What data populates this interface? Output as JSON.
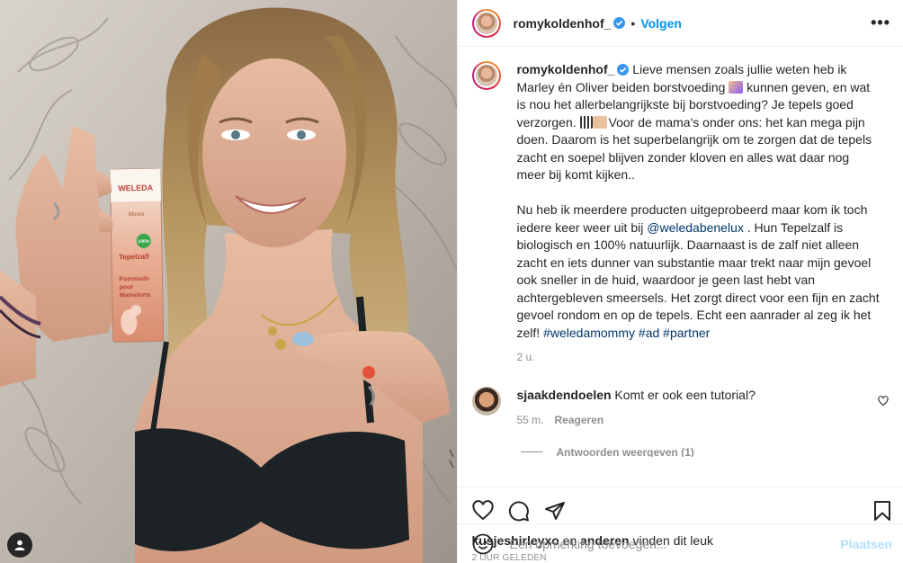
{
  "header": {
    "username": "romykoldenhof_",
    "dot": "•",
    "follow_label": "Volgen",
    "more_label": "•••"
  },
  "caption": {
    "username": "romykoldenhof_",
    "text_1": " Lieve mensen zoals jullie weten heb ik Marley én Oliver beiden borstvoeding ",
    "text_2": " kunnen geven, en wat is nou het allerbelangrijkste bij borstvoeding? Je tepels goed verzorgen. ",
    "text_3": "Voor de mama's onder ons: het kan mega pijn doen. Daarom is het superbelangrijk om te zorgen dat de tepels zacht en soepel blijven zonder kloven en alles wat daar nog meer bij komt kijken..",
    "text_4a": "Nu heb ik meerdere producten uitgeprobeerd maar kom ik toch iedere keer weer uit bij ",
    "mention": "@weledabenelux",
    "text_4b": " . Hun Tepelzalf is biologisch en 100% natuurlijk. Daarnaast is de zalf niet alleen zacht en iets dunner van substantie maar trekt naar mijn gevoel ook sneller in de huid, waardoor je geen last hebt van achtergebleven smeersels. Het zorgt direct voor een fijn en zacht gevoel rondom en op de tepels. Echt een aanrader al zeg ik het zelf! ",
    "hashtag_1": "#weledamommy",
    "hashtag_2": "#ad",
    "hashtag_3": "#partner",
    "time": "2 u."
  },
  "comments": [
    {
      "username": "sjaakdendoelen",
      "text": " Komt er ook een tutorial?",
      "time": "55 m.",
      "reply_label": "Reageren",
      "view_replies": "Antwoorden weergeven (1)"
    }
  ],
  "likes": {
    "user": "kusjeshirleyxo",
    "conj": " en ",
    "others": "anderen",
    "suffix": " vinden dit leuk"
  },
  "posted_ago": "2 UUR GELEDEN",
  "add_comment": {
    "placeholder": "Een opmerking toevoegen...",
    "post_label": "Plaatsen"
  },
  "product": {
    "brand": "WELEDA",
    "line": "Mama",
    "name": "Tepelzalf",
    "name_fr": "Pommade pour Mamelons",
    "badge": "100%"
  },
  "colors": {
    "accent": "#0095f6",
    "link": "#00376b",
    "muted": "#8e8e8e",
    "post_disabled": "#b2dffc"
  }
}
